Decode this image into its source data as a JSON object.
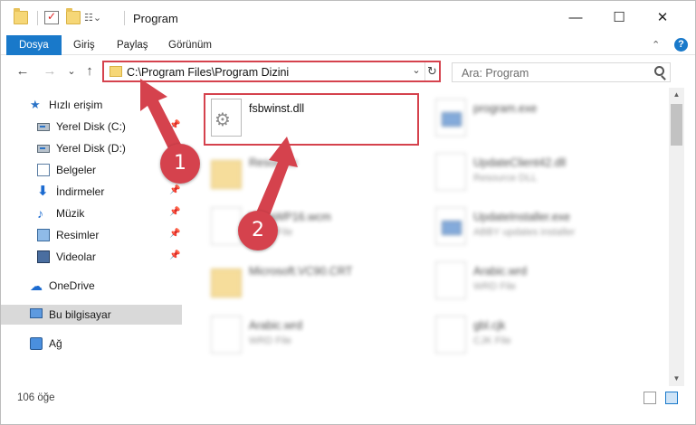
{
  "window": {
    "title": "Program",
    "controls": {
      "minimize": "—",
      "maximize": "☐",
      "close": "✕"
    }
  },
  "ribbon": {
    "tabs": [
      "Dosya",
      "Giriş",
      "Paylaş",
      "Görünüm"
    ],
    "collapse_icon": "⌄",
    "help_label": "?"
  },
  "nav": {
    "back": "←",
    "forward": "→",
    "recent": "⌄",
    "up": "↑",
    "address_path": "C:\\Program Files\\Program Dizini",
    "address_dropdown": "⌄",
    "refresh": "↻",
    "search_placeholder": "Ara: Program"
  },
  "sidebar": {
    "items": [
      {
        "label": "Hızlı erişim",
        "icon": "star-icon",
        "pinned": false
      },
      {
        "label": "Yerel Disk (C:)",
        "icon": "drive-icon",
        "pinned": true
      },
      {
        "label": "Yerel Disk (D:)",
        "icon": "drive-icon",
        "pinned": false
      },
      {
        "label": "Belgeler",
        "icon": "document-icon",
        "pinned": true
      },
      {
        "label": "İndirmeler",
        "icon": "download-icon",
        "pinned": true
      },
      {
        "label": "Müzik",
        "icon": "music-icon",
        "pinned": true
      },
      {
        "label": "Resimler",
        "icon": "pictures-icon",
        "pinned": true
      },
      {
        "label": "Videolar",
        "icon": "video-icon",
        "pinned": true
      },
      {
        "label": "OneDrive",
        "icon": "cloud-icon",
        "pinned": false
      },
      {
        "label": "Bu bilgisayar",
        "icon": "computer-icon",
        "pinned": false,
        "selected": true
      },
      {
        "label": "Ağ",
        "icon": "network-icon",
        "pinned": false
      }
    ],
    "pin_glyph": "📌"
  },
  "files": [
    {
      "name": "fsbwinst.dll",
      "type": "",
      "icon": "dll-icon",
      "blurred": false
    },
    {
      "name": "program.exe",
      "type": "",
      "icon": "exe-icon",
      "blurred": true
    },
    {
      "name": "Resource",
      "type": "",
      "icon": "folder-icon",
      "blurred": true
    },
    {
      "name": "UpdateClient42.dll",
      "type": "Resource DLL",
      "icon": "file-icon",
      "blurred": true
    },
    {
      "name": "VistaWP16.wcm",
      "type": "WCM File",
      "icon": "file-icon",
      "blurred": true
    },
    {
      "name": "UpdateInstaller.exe",
      "type": "ABBY updates installer",
      "icon": "exe-icon",
      "blurred": true
    },
    {
      "name": "Microsoft.VC90.CRT",
      "type": "",
      "icon": "folder-icon",
      "blurred": true
    },
    {
      "name": "Arabic.wrd",
      "type": "WRD File",
      "icon": "file-icon",
      "blurred": true
    },
    {
      "name": "Arabic.wrd",
      "type": "WRD File",
      "icon": "file-icon",
      "blurred": true
    },
    {
      "name": "gbl.cjk",
      "type": "CJK File",
      "icon": "file-icon",
      "blurred": true
    }
  ],
  "callouts": {
    "one": "1",
    "two": "2"
  },
  "status": {
    "item_count": "106 öğe"
  },
  "colors": {
    "accent": "#1979ca",
    "highlight": "#d5424d",
    "selected_bg": "#d9d9d9"
  }
}
